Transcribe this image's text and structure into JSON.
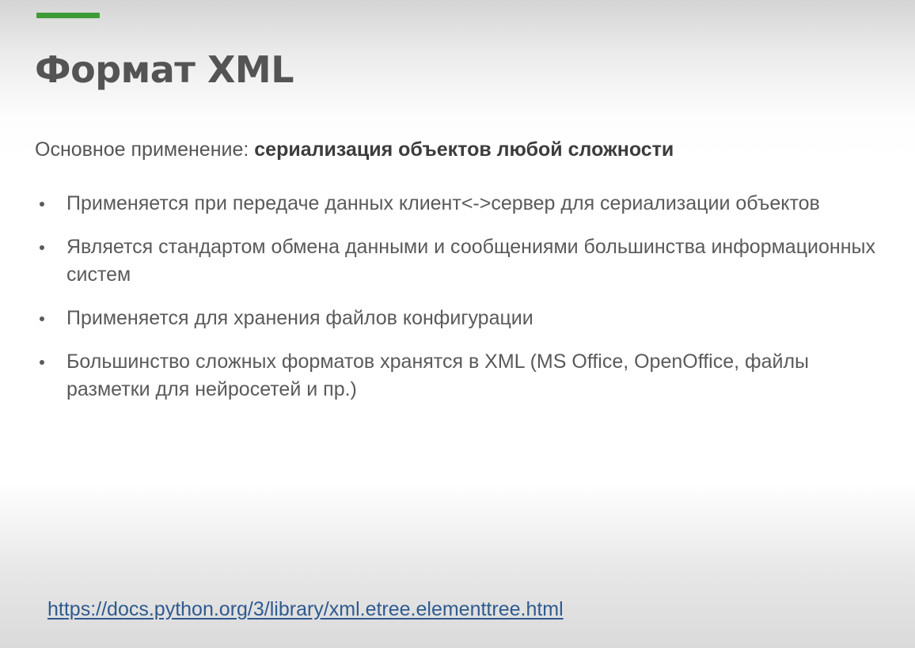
{
  "slide": {
    "title": "Формат XML",
    "subtitle_regular": "Основное применение: ",
    "subtitle_bold": "сериализация объектов любой сложности",
    "bullets": [
      "Применяется при передаче данных клиент<->сервер для сериализации объектов",
      "Является стандартом обмена данными и сообщениями большинства информационных систем",
      "Применяется для хранения файлов конфигурации",
      "Большинство сложных форматов хранятся в XML (MS Office, OpenOffice, файлы разметки для нейросетей и пр.)"
    ],
    "link_text": "https://docs.python.org/3/library/xml.etree.elementtree.html"
  },
  "colors": {
    "accent": "#3f9b37",
    "title": "#545454",
    "body_text": "#5a5a5a",
    "link": "#2e5a8f"
  }
}
